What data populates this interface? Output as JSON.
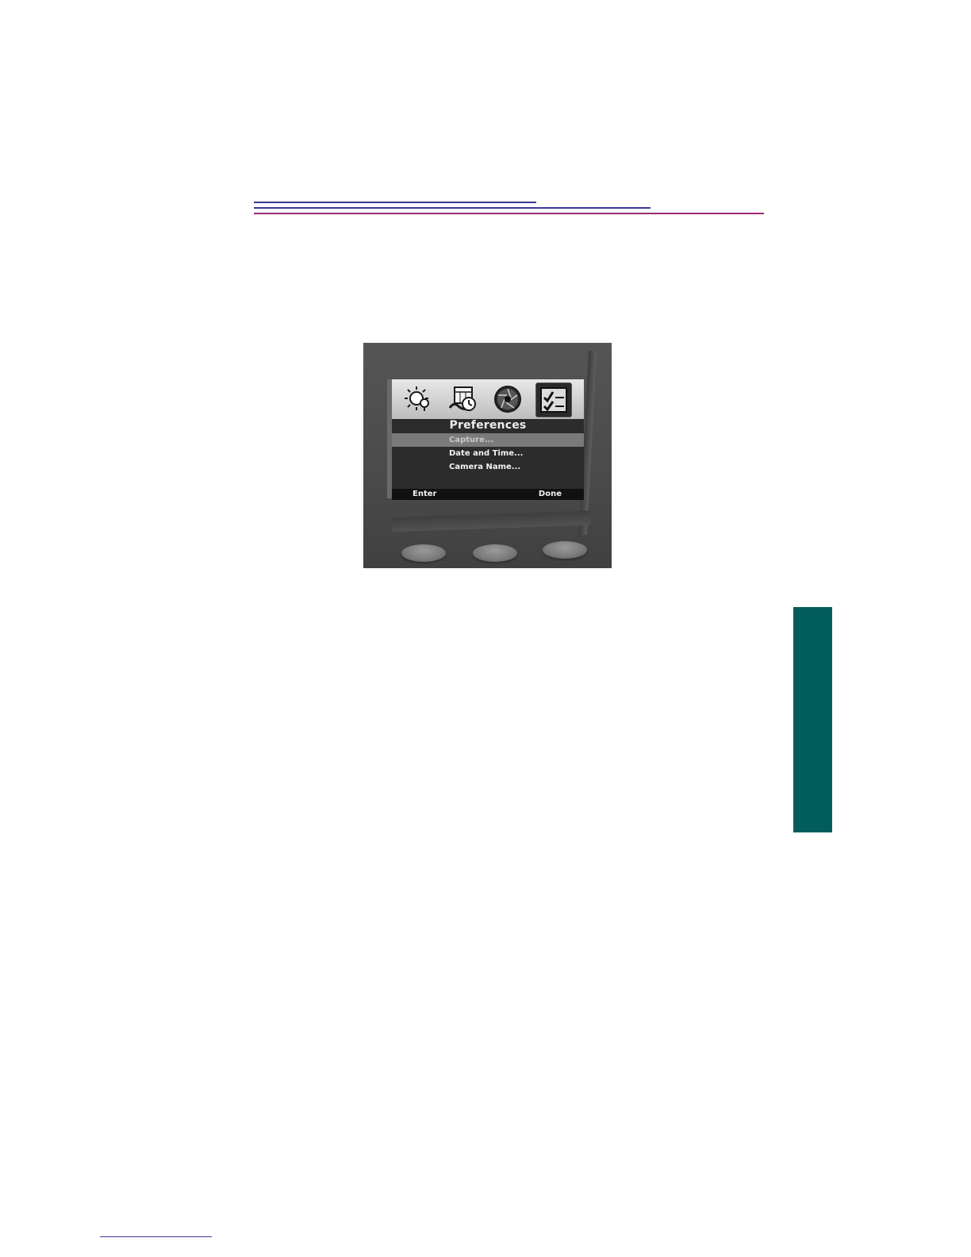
{
  "device_screen": {
    "tabs": [
      {
        "icon": "light-meter-icon",
        "selected": false
      },
      {
        "icon": "calendar-clock-icon",
        "selected": false
      },
      {
        "icon": "aperture-icon",
        "selected": false
      },
      {
        "icon": "preferences-checklist-icon",
        "selected": true
      }
    ],
    "title": "Preferences",
    "menu_items": [
      {
        "label": "Capture...",
        "highlighted": true
      },
      {
        "label": "Date and Time...",
        "highlighted": false
      },
      {
        "label": "Camera Name...",
        "highlighted": false
      }
    ],
    "softkeys": {
      "left": "Enter",
      "right": "Done"
    }
  },
  "colors": {
    "side_tab": "#005d5c",
    "rule_blue": "#3a3a9a",
    "rule_magenta": "#9a2a72"
  }
}
